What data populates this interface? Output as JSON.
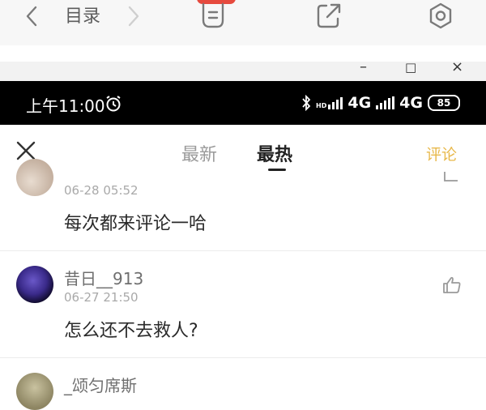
{
  "topbar": {
    "catalog_label": "目录",
    "icons": [
      "back-icon",
      "forward-icon",
      "bookmark-icon",
      "share-icon",
      "settings-icon"
    ]
  },
  "window": {
    "min": "–",
    "max": "□",
    "close": "×"
  },
  "statusbar": {
    "time": "上午11:00",
    "net1": "4G",
    "net2": "4G",
    "battery": "85",
    "hd": "HD"
  },
  "tabs": {
    "newest": "最新",
    "hottest": "最热",
    "comment_button": "评论"
  },
  "comments": [
    {
      "time": "06-28 05:52",
      "text": "每次都来评论一哈"
    },
    {
      "user": "昔日__913",
      "time": "06-27 21:50",
      "text": "怎么还不去救人?"
    },
    {
      "user": "_颂匀席斯"
    }
  ],
  "colors": {
    "accent": "#e8b84a",
    "badge": "#e64a3e"
  }
}
